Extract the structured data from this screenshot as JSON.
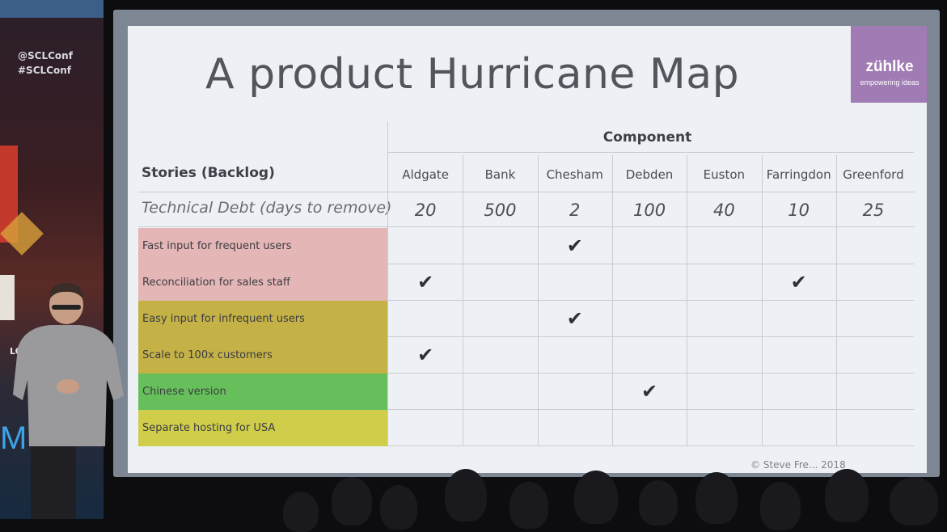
{
  "banner": {
    "handle_1": "@SCLConf",
    "handle_2": "#SCLConf",
    "partial_text": "LO",
    "partial_letter": "M"
  },
  "slide": {
    "title": "A product Hurricane Map",
    "logo": {
      "name": "zühlke",
      "tagline": "empowering ideas",
      "color": "#a07bb4"
    },
    "component_header": "Component",
    "stories_header": "Stories (Backlog)",
    "debt_label": "Technical Debt (days to remove)",
    "components": [
      {
        "name": "Aldgate",
        "debt": "20"
      },
      {
        "name": "Bank",
        "debt": "500"
      },
      {
        "name": "Chesham",
        "debt": "2"
      },
      {
        "name": "Debden",
        "debt": "100"
      },
      {
        "name": "Euston",
        "debt": "40"
      },
      {
        "name": "Farringdon",
        "debt": "10"
      },
      {
        "name": "Greenford",
        "debt": "25"
      }
    ],
    "stories": [
      {
        "label": "Fast input for frequent users",
        "color": "#e4b6b5",
        "checks": [
          "Chesham"
        ]
      },
      {
        "label": "Reconciliation for sales staff",
        "color": "#e4b6b5",
        "checks": [
          "Aldgate",
          "Farringdon"
        ]
      },
      {
        "label": "Easy input for infrequent users",
        "color": "#c4b246",
        "checks": [
          "Chesham"
        ]
      },
      {
        "label": "Scale to 100x customers",
        "color": "#c4b246",
        "checks": [
          "Aldgate"
        ]
      },
      {
        "label": "Chinese version",
        "color": "#66bf5a",
        "checks": [
          "Debden"
        ]
      },
      {
        "label": "Separate hosting for USA",
        "color": "#cfcd49",
        "checks": []
      }
    ],
    "check_glyph": "✔",
    "credit": "© Steve Fre... 2018"
  }
}
